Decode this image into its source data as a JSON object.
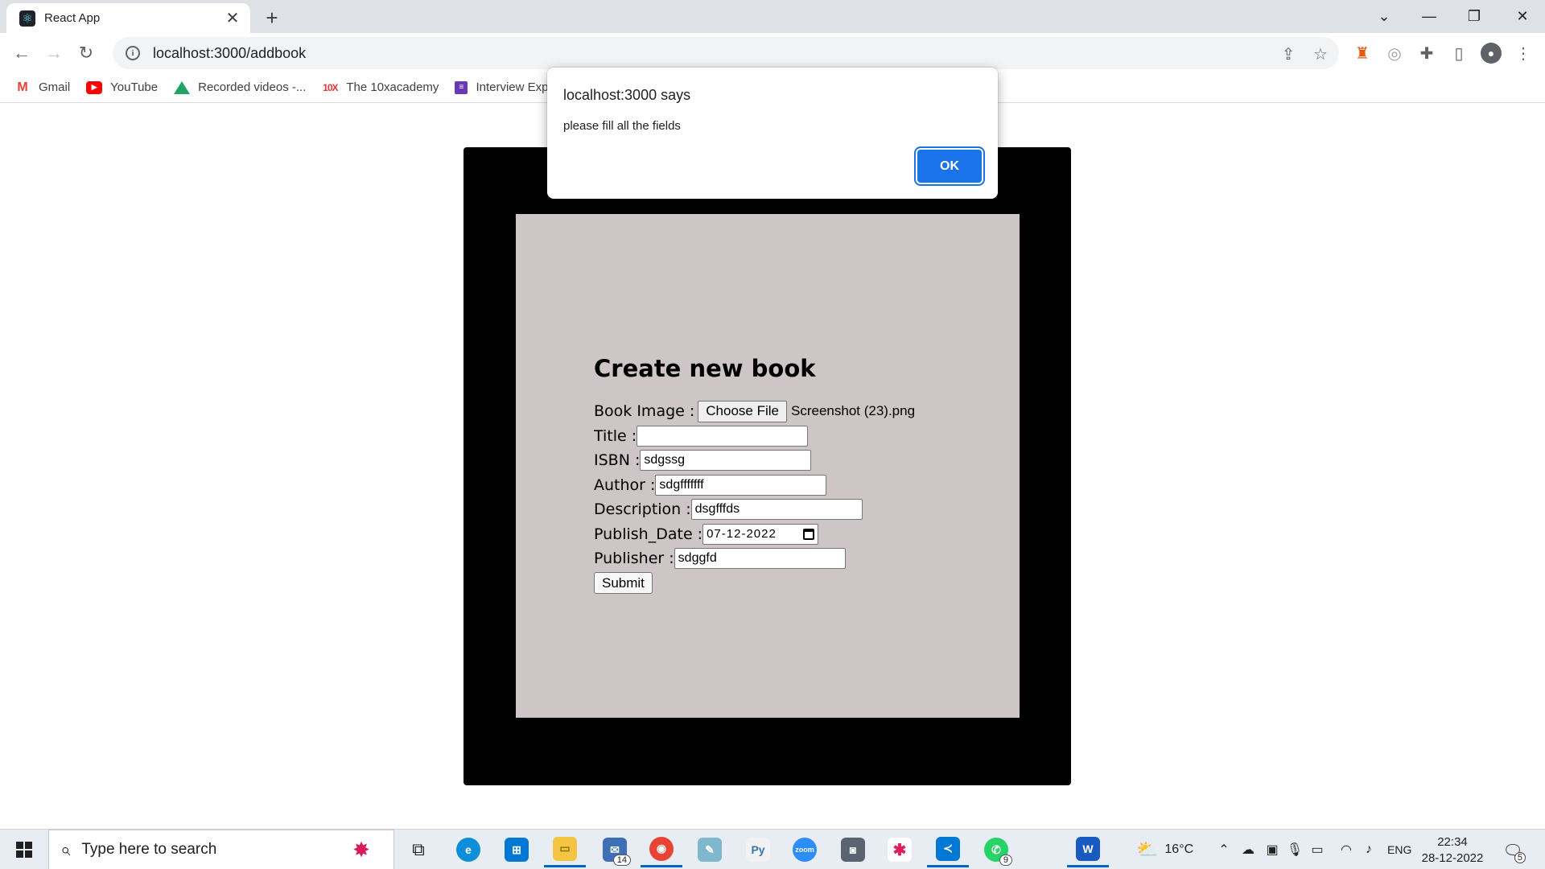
{
  "browser": {
    "tab_title": "React App",
    "url": "localhost:3000/addbook"
  },
  "bookmarks": [
    {
      "label": "Gmail",
      "icon": "gmail-icon"
    },
    {
      "label": "YouTube",
      "icon": "youtube-icon"
    },
    {
      "label": "Recorded videos -...",
      "icon": "google-drive-icon"
    },
    {
      "label": "The 10xacademy",
      "icon": "10x-icon"
    },
    {
      "label": "Interview Expe",
      "icon": "forms-icon"
    }
  ],
  "form": {
    "title": "Create new book",
    "book_image_label": "Book Image :",
    "choose_file_label": "Choose File",
    "file_name": "Screenshot (23).png",
    "title_label": "Title :",
    "title_value": "",
    "isbn_label": "ISBN :",
    "isbn_value": "sdgssg",
    "author_label": "Author :",
    "author_value": "sdgfffffff",
    "description_label": "Description :",
    "description_value": "dsgfffds",
    "publish_date_label": "Publish_Date :",
    "publish_date_value": "07-12-2022",
    "publisher_label": "Publisher :",
    "publisher_value": "sdggfd",
    "submit_label": "Submit"
  },
  "dialog": {
    "title": "localhost:3000 says",
    "message": "please fill all the fields",
    "ok_label": "OK"
  },
  "taskbar": {
    "search_placeholder": "Type here to search",
    "mail_badge": "14",
    "whatsapp_badge": "9",
    "temperature": "16°C",
    "language": "ENG",
    "time": "22:34",
    "date": "28-12-2022",
    "notification_count": "5"
  },
  "colors": {
    "accent": "#1a73e8",
    "outer_frame": "#000000",
    "form_panel": "#cdc5c6"
  }
}
